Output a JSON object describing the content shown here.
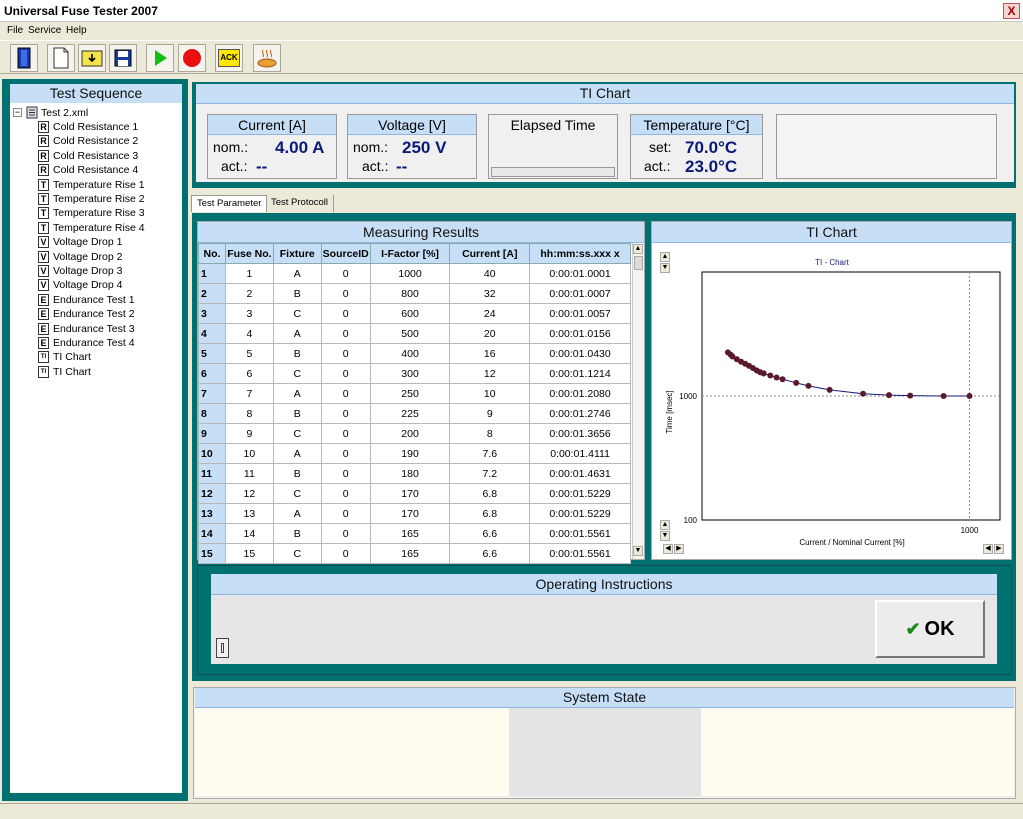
{
  "window": {
    "title": "Universal Fuse Tester 2007",
    "close": "X"
  },
  "menu": [
    "File",
    "Service",
    "Help"
  ],
  "toolbar": {
    "ack_label": "ACK"
  },
  "sidebar": {
    "title": "Test Sequence",
    "root": "Test 2.xml",
    "items": [
      {
        "icon": "R",
        "label": "Cold Resistance 1"
      },
      {
        "icon": "R",
        "label": "Cold Resistance 2"
      },
      {
        "icon": "R",
        "label": "Cold Resistance 3"
      },
      {
        "icon": "R",
        "label": "Cold Resistance 4"
      },
      {
        "icon": "T",
        "label": "Temperature Rise 1"
      },
      {
        "icon": "T",
        "label": "Temperature Rise 2"
      },
      {
        "icon": "T",
        "label": "Temperature Rise 3"
      },
      {
        "icon": "T",
        "label": "Temperature Rise 4"
      },
      {
        "icon": "V",
        "label": "Voltage Drop 1"
      },
      {
        "icon": "V",
        "label": "Voltage Drop 2"
      },
      {
        "icon": "V",
        "label": "Voltage Drop 3"
      },
      {
        "icon": "V",
        "label": "Voltage Drop 4"
      },
      {
        "icon": "E",
        "label": "Endurance Test 1"
      },
      {
        "icon": "E",
        "label": "Endurance Test 2"
      },
      {
        "icon": "E",
        "label": "Endurance Test 3"
      },
      {
        "icon": "E",
        "label": "Endurance Test 4"
      },
      {
        "icon": "TI",
        "label": "TI Chart"
      },
      {
        "icon": "TI",
        "label": "TI Chart"
      }
    ]
  },
  "top_panel": {
    "title": "TI Chart",
    "current": {
      "title": "Current [A]",
      "nom_label": "nom.:",
      "nom": "4.00 A",
      "act_label": "act.:",
      "act": "--"
    },
    "voltage": {
      "title": "Voltage [V]",
      "nom_label": "nom.:",
      "nom": "250 V",
      "act_label": "act.:",
      "act": "--"
    },
    "elapsed": {
      "title": "Elapsed Time"
    },
    "temperature": {
      "title": "Temperature [°C]",
      "set_label": "set:",
      "set": "70.0°C",
      "act_label": "act.:",
      "act": "23.0°C"
    }
  },
  "tabs": [
    "Test Parameter",
    "Test Protocoll"
  ],
  "results": {
    "title": "Measuring Results",
    "columns": [
      "No.",
      "Fuse No.",
      "Fixture",
      "SourceID",
      "I-Factor [%]",
      "Current [A]",
      "hh:mm:ss.xxx x"
    ],
    "rows": [
      [
        "1",
        "1",
        "A",
        "0",
        "1000",
        "40",
        "0:00:01.0001"
      ],
      [
        "2",
        "2",
        "B",
        "0",
        "800",
        "32",
        "0:00:01.0007"
      ],
      [
        "3",
        "3",
        "C",
        "0",
        "600",
        "24",
        "0:00:01.0057"
      ],
      [
        "4",
        "4",
        "A",
        "0",
        "500",
        "20",
        "0:00:01.0156"
      ],
      [
        "5",
        "5",
        "B",
        "0",
        "400",
        "16",
        "0:00:01.0430"
      ],
      [
        "6",
        "6",
        "C",
        "0",
        "300",
        "12",
        "0:00:01.1214"
      ],
      [
        "7",
        "7",
        "A",
        "0",
        "250",
        "10",
        "0:00:01.2080"
      ],
      [
        "8",
        "8",
        "B",
        "0",
        "225",
        "9",
        "0:00:01.2746"
      ],
      [
        "9",
        "9",
        "C",
        "0",
        "200",
        "8",
        "0:00:01.3656"
      ],
      [
        "10",
        "10",
        "A",
        "0",
        "190",
        "7.6",
        "0:00:01.4111"
      ],
      [
        "11",
        "11",
        "B",
        "0",
        "180",
        "7.2",
        "0:00:01.4631"
      ],
      [
        "12",
        "12",
        "C",
        "0",
        "170",
        "6.8",
        "0:00:01.5229"
      ],
      [
        "13",
        "13",
        "A",
        "0",
        "170",
        "6.8",
        "0:00:01.5229"
      ],
      [
        "14",
        "14",
        "B",
        "0",
        "165",
        "6.6",
        "0:00:01.5561"
      ],
      [
        "15",
        "15",
        "C",
        "0",
        "165",
        "6.6",
        "0:00:01.5561"
      ]
    ]
  },
  "chart_panel": {
    "title": "TI Chart"
  },
  "chart_data": {
    "type": "scatter",
    "title": "TI - Chart",
    "xlabel": "Current / Nominal Current [%]",
    "ylabel": "Time [msec]",
    "x_ticks": [
      "1000"
    ],
    "y_ticks": [
      "100",
      "1000"
    ],
    "xlog": true,
    "ylog": true,
    "xlim": [
      100,
      1300
    ],
    "ylim": [
      100,
      10000
    ],
    "x": [
      1000,
      800,
      600,
      500,
      400,
      300,
      250,
      225,
      200,
      190,
      180,
      170,
      170,
      165,
      165,
      160,
      155,
      150,
      145,
      140,
      135,
      130,
      128,
      125
    ],
    "y": [
      1000,
      1001,
      1006,
      1016,
      1043,
      1121,
      1208,
      1275,
      1366,
      1411,
      1463,
      1523,
      1523,
      1556,
      1556,
      1610,
      1680,
      1750,
      1820,
      1890,
      1980,
      2080,
      2150,
      2250
    ],
    "grid": true,
    "point_color": "#5a1a2a",
    "line_color": "#1a1a80"
  },
  "instructions": {
    "title": "Operating Instructions",
    "ok_check": "✔",
    "ok_label": "OK"
  },
  "system_state": {
    "title": "System State"
  }
}
